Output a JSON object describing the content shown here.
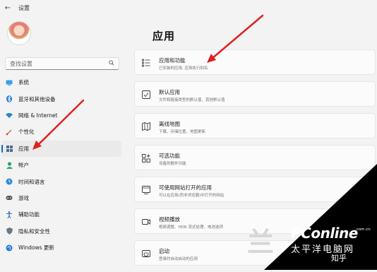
{
  "window": {
    "back_glyph": "←",
    "title": "设置"
  },
  "search": {
    "placeholder": "查找设置"
  },
  "nav": {
    "items": [
      {
        "label": "系统",
        "icon": "system-monitor-icon",
        "selected": false
      },
      {
        "label": "蓝牙和其他设备",
        "icon": "bluetooth-icon",
        "selected": false
      },
      {
        "label": "网络 & Internet",
        "icon": "network-icon",
        "selected": false
      },
      {
        "label": "个性化",
        "icon": "brush-icon",
        "selected": false
      },
      {
        "label": "应用",
        "icon": "apps-icon",
        "selected": true
      },
      {
        "label": "帐户",
        "icon": "account-icon",
        "selected": false
      },
      {
        "label": "时间和语言",
        "icon": "globe-clock-icon",
        "selected": false
      },
      {
        "label": "游戏",
        "icon": "gamepad-icon",
        "selected": false
      },
      {
        "label": "辅助功能",
        "icon": "accessibility-icon",
        "selected": false
      },
      {
        "label": "隐私和安全性",
        "icon": "shield-icon",
        "selected": false
      },
      {
        "label": "Windows 更新",
        "icon": "update-icon",
        "selected": false
      }
    ]
  },
  "main": {
    "title": "应用",
    "cards": [
      {
        "title": "应用和功能",
        "desc": "已安装的应用, 应用执行别名",
        "icon": "list-icon"
      },
      {
        "title": "默认应用",
        "desc": "文件和链接类型的默认值、其他默认值",
        "icon": "default-apps-icon"
      },
      {
        "title": "离线地图",
        "desc": "下载、存储位置、地图更新",
        "icon": "map-icon"
      },
      {
        "title": "可选功能",
        "desc": "设备的额外功能",
        "icon": "add-feature-icon"
      },
      {
        "title": "可使用网站打开的应用",
        "desc": "可以在应用(而非浏览器)中打开的网站",
        "icon": "web-app-icon"
      },
      {
        "title": "视频播放",
        "desc": "视频调整、HDR 流式处理、电池选项",
        "icon": "video-icon"
      },
      {
        "title": "启动",
        "desc": "登录时自动启动的应用",
        "icon": "startup-icon"
      }
    ]
  },
  "watermark": {
    "ghost": "兰",
    "brand": "PConline",
    "domain": ".com.cn",
    "brand_cn": "太平洋电脑网",
    "zhihu": "知乎"
  },
  "colors": {
    "accent": "#0067c0",
    "annotation_arrow": "#e02020",
    "background": "#f3f3f3",
    "card": "#fbfbfb"
  }
}
